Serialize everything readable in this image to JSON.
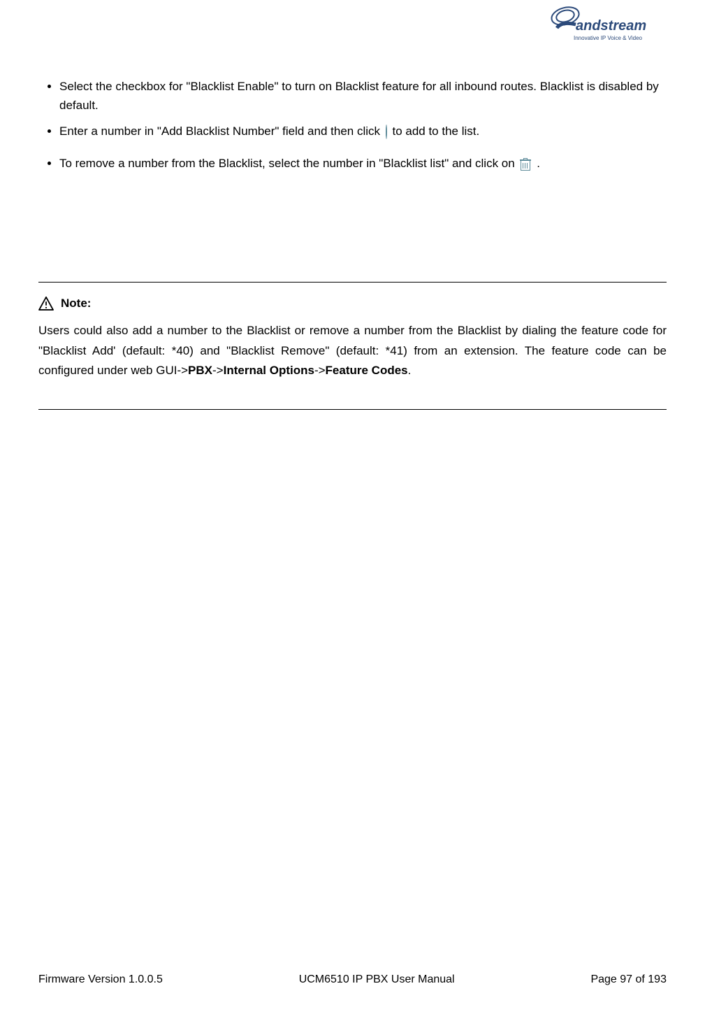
{
  "header": {
    "logo_brand": "Grandstream",
    "logo_tag": "Innovative IP Voice & Video"
  },
  "bullets": {
    "item1": "Select the checkbox for \"Blacklist Enable\" to turn on Blacklist feature for all inbound routes. Blacklist is disabled by default.",
    "item2_part1": "Enter a number in \"Add Blacklist Number\" field and then click ",
    "item2_part2": " to add to the list.",
    "item3_part1": "To remove a number from the Blacklist, select the number in \"Blacklist list\" and click on ",
    "item3_part2": "."
  },
  "note": {
    "label": "Note:",
    "body_part1": "Users could also add a number to the Blacklist or remove a number from the Blacklist by dialing the feature code for \"Blacklist Add' (default: *40) and \"Blacklist Remove\" (default: *41) from an extension. The feature code can be configured under web GUI->",
    "pbx": "PBX",
    "arrow1": "->",
    "internal_options": "Internal Options",
    "arrow2": "->",
    "feature_codes": "Feature Codes",
    "period": "."
  },
  "footer": {
    "firmware": "Firmware Version 1.0.0.5",
    "manual": "UCM6510 IP PBX User Manual",
    "page": "Page 97 of 193"
  }
}
